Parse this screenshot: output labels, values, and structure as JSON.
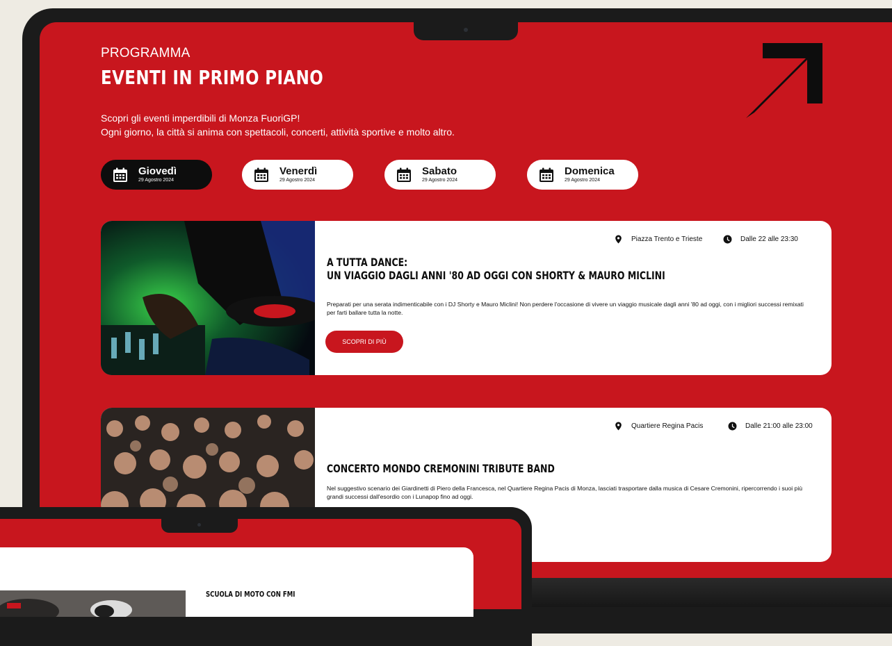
{
  "section": {
    "eyebrow": "PROGRAMMA",
    "title": "EVENTI IN PRIMO PIANO",
    "intro_line1": "Scopri gli eventi imperdibili di Monza FuoriGP!",
    "intro_line2": "Ogni giorno, la città si anima con spettacoli, concerti, attività sportive e molto altro."
  },
  "days": [
    {
      "name": "Giovedì",
      "date": "29 Agostro 2024",
      "active": true
    },
    {
      "name": "Venerdì",
      "date": "29 Agostro 2024",
      "active": false
    },
    {
      "name": "Sabato",
      "date": "29 Agostro 2024",
      "active": false
    },
    {
      "name": "Domenica",
      "date": "29 Agostro 2024",
      "active": false
    }
  ],
  "events": [
    {
      "location": "Piazza Trento e Trieste",
      "time": "Dalle 22 alle 23:30",
      "title_line1": "A TUTTA DANCE:",
      "title_line2": "UN VIAGGIO DAGLI ANNI '80 AD OGGI CON SHORTY & MAURO MICLINI",
      "description": "Preparati per una serata indimenticabile con i DJ Shorty e Mauro Miclini! Non perdere l'occasione di vivere un viaggio musicale dagli anni '80 ad oggi, con i migliori successi remixati per farti ballare tutta la notte.",
      "cta": "SCOPRI DI PIÙ"
    },
    {
      "location": "Quartiere Regina Pacis",
      "time": "Dalle 21:00 alle 23:00",
      "title": "CONCERTO MONDO CREMONINI TRIBUTE BAND",
      "description": "Nel suggestivo scenario dei Giardinetti di Piero della Francesca, nel Quartiere Regina Pacis di Monza, lasciati trasportare dalla musica di Cesare Cremonini, ripercorrendo i suoi più grandi successi dall'esordio con i Lunapop fino ad oggi."
    }
  ],
  "second_device": {
    "event_title": "SCUOLA DI MOTO CON FMI"
  },
  "colors": {
    "brand_red": "#c8161e",
    "black": "#0d0d0d",
    "background": "#eeebe3"
  },
  "icons": [
    "calendar-icon",
    "location-pin-icon",
    "clock-icon",
    "arrow-up-right-icon"
  ]
}
